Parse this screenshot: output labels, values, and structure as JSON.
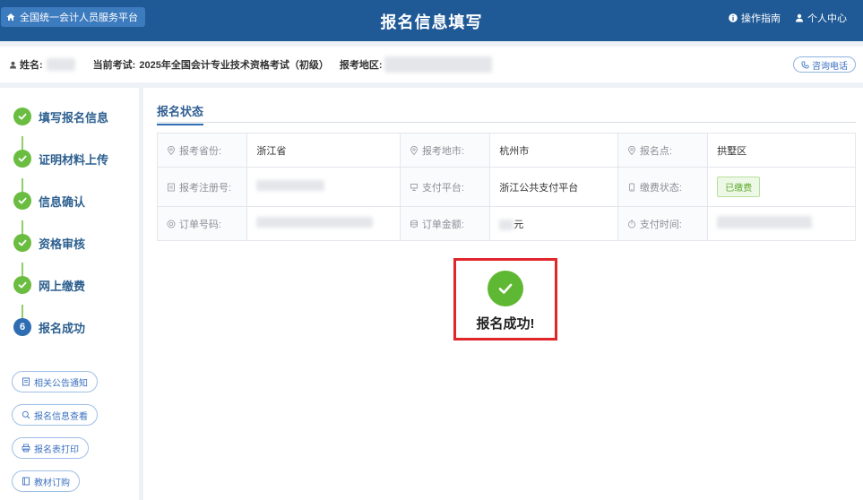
{
  "header": {
    "home_link": "全国统一会计人员服务平台",
    "title": "报名信息填写",
    "guide": "操作指南",
    "profile": "个人中心"
  },
  "info_bar": {
    "name_label": "姓名:",
    "exam_label": "当前考试:",
    "exam_value": "2025年全国会计专业技术资格考试（初级）",
    "region_label": "报考地区:",
    "consult_button": "咨询电话"
  },
  "steps": [
    {
      "label": "填写报名信息",
      "status": "done"
    },
    {
      "label": "证明材料上传",
      "status": "done"
    },
    {
      "label": "信息确认",
      "status": "done"
    },
    {
      "label": "资格审核",
      "status": "done"
    },
    {
      "label": "网上缴费",
      "status": "done"
    },
    {
      "label": "报名成功",
      "status": "current",
      "number": "6"
    }
  ],
  "side_buttons": [
    {
      "label": "相关公告通知",
      "icon": "notice-icon"
    },
    {
      "label": "报名信息查看",
      "icon": "search-icon"
    },
    {
      "label": "报名表打印",
      "icon": "print-icon"
    },
    {
      "label": "教材订购",
      "icon": "book-icon"
    }
  ],
  "main": {
    "section_title": "报名状态",
    "table": {
      "province_label": "报考省份:",
      "province_value": "浙江省",
      "city_label": "报考地市:",
      "city_value": "杭州市",
      "site_label": "报名点:",
      "site_value": "拱墅区",
      "reg_label": "报考注册号:",
      "pay_platform_label": "支付平台:",
      "pay_platform_value": "浙江公共支付平台",
      "pay_status_label": "缴费状态:",
      "pay_status_value": "已缴费",
      "order_label": "订单号码:",
      "amount_label": "订单金额:",
      "amount_unit": "元",
      "pay_time_label": "支付时间:"
    },
    "success_text": "报名成功!"
  },
  "colors": {
    "header_bg": "#1f5a97",
    "step_done": "#6abd40",
    "step_current": "#2f6db3",
    "success_border": "#e0262b"
  }
}
